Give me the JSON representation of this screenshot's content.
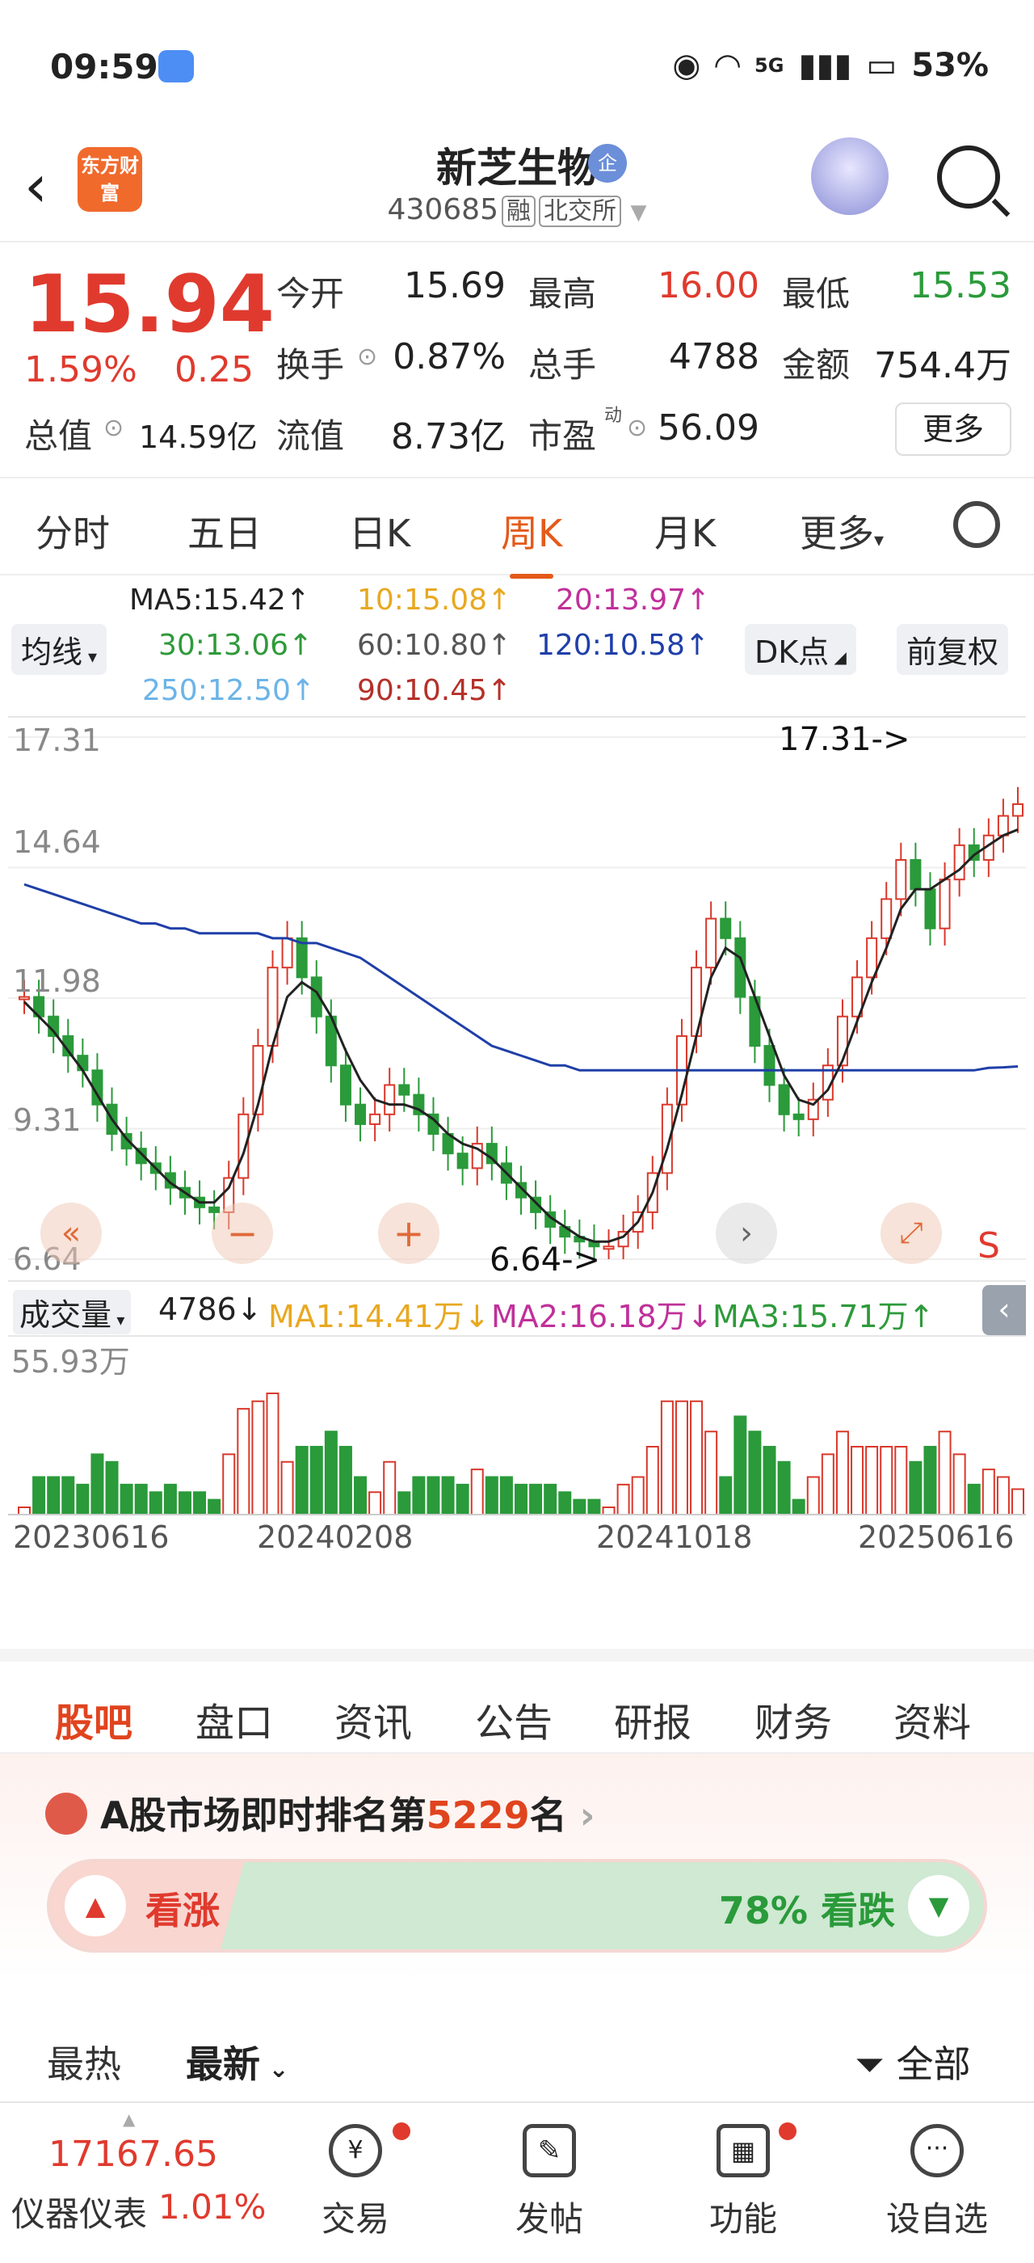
{
  "status": {
    "time": "09:59",
    "network": "5G",
    "battery": "53%"
  },
  "header": {
    "name": "新芝生物",
    "badge": "企",
    "code": "430685",
    "tags": [
      "融",
      "北交所"
    ],
    "logo_text": "东方财富"
  },
  "quote": {
    "price": "15.94",
    "change_pct": "1.59%",
    "change": "0.25",
    "open_label": "今开",
    "open": "15.69",
    "high_label": "最高",
    "high": "16.00",
    "low_label": "最低",
    "low": "15.53",
    "turnover_label": "换手",
    "turnover": "0.87%",
    "volume_label": "总手",
    "volume": "4788",
    "amount_label": "金额",
    "amount": "754.4万",
    "mktcap_label": "总值",
    "mktcap": "14.59亿",
    "float_label": "流值",
    "float": "8.73亿",
    "pe_label": "市盈",
    "pe_sup": "动",
    "pe": "56.09",
    "more": "更多"
  },
  "periods": [
    "分时",
    "五日",
    "日K",
    "周K",
    "月K",
    "更多"
  ],
  "active_period": "周K",
  "ma_legend": {
    "indicator": "均线",
    "dk": "DK点",
    "adjust": "前复权",
    "ma5": "MA5:15.42↑",
    "ma10": "10:15.08↑",
    "ma20": "20:13.97↑",
    "ma30": "30:13.06↑",
    "ma60": "60:10.80↑",
    "ma120": "120:10.58↑",
    "ma250": "250:12.50↑",
    "ma90": "90:10.45↑",
    "colors": {
      "ma5": "#222222",
      "ma10": "#f0b429",
      "ma20": "#c0309a",
      "ma30": "#2e9a3a",
      "ma60": "#555555",
      "ma120": "#1f3fa8",
      "ma250": "#6cb4e8",
      "ma90": "#b5302a"
    }
  },
  "chart_data": {
    "type": "candlestick",
    "y_ticks": [
      "17.31",
      "14.64",
      "11.98",
      "9.31",
      "6.64"
    ],
    "ylim": [
      6.64,
      17.31
    ],
    "max_label": "17.31->",
    "min_label": "6.64->",
    "x_ticks": [
      "20230616",
      "20240208",
      "20241018",
      "20250616"
    ],
    "close": [
      12.0,
      11.6,
      11.2,
      10.8,
      10.5,
      9.8,
      9.2,
      8.9,
      8.6,
      8.4,
      8.1,
      7.9,
      7.7,
      7.6,
      8.3,
      9.6,
      11.0,
      12.6,
      13.2,
      12.4,
      11.6,
      10.6,
      9.8,
      9.4,
      9.6,
      10.2,
      10.0,
      9.6,
      9.2,
      8.8,
      8.5,
      9.0,
      8.6,
      8.2,
      7.9,
      7.6,
      7.3,
      7.1,
      7.0,
      6.9,
      6.9,
      7.2,
      7.6,
      8.4,
      9.8,
      11.2,
      12.6,
      13.6,
      13.2,
      12.0,
      11.0,
      10.2,
      9.6,
      9.5,
      9.9,
      10.6,
      11.6,
      12.4,
      13.2,
      14.0,
      14.8,
      14.2,
      13.4,
      14.4,
      15.1,
      14.8,
      15.3,
      15.7,
      15.94
    ],
    "ma5": [
      11.9,
      11.6,
      11.3,
      10.9,
      10.5,
      10.0,
      9.5,
      9.1,
      8.8,
      8.5,
      8.2,
      8.0,
      7.8,
      7.8,
      8.1,
      8.8,
      9.8,
      11.0,
      12.0,
      12.3,
      12.1,
      11.6,
      10.9,
      10.3,
      9.9,
      9.8,
      9.8,
      9.7,
      9.5,
      9.2,
      9.0,
      8.9,
      8.7,
      8.4,
      8.1,
      7.8,
      7.5,
      7.3,
      7.1,
      7.0,
      7.0,
      7.1,
      7.4,
      8.0,
      8.9,
      10.0,
      11.2,
      12.4,
      13.0,
      12.8,
      12.0,
      11.2,
      10.4,
      9.9,
      9.8,
      10.1,
      10.7,
      11.5,
      12.3,
      13.0,
      13.8,
      14.2,
      14.2,
      14.4,
      14.6,
      14.9,
      15.1,
      15.3,
      15.42
    ],
    "ma120": [
      14.3,
      14.2,
      14.1,
      14.0,
      13.9,
      13.8,
      13.7,
      13.6,
      13.5,
      13.5,
      13.4,
      13.4,
      13.3,
      13.3,
      13.3,
      13.3,
      13.3,
      13.2,
      13.2,
      13.1,
      13.1,
      13.0,
      12.9,
      12.8,
      12.6,
      12.4,
      12.2,
      12.0,
      11.8,
      11.6,
      11.4,
      11.2,
      11.0,
      10.9,
      10.8,
      10.7,
      10.6,
      10.6,
      10.5,
      10.5,
      10.5,
      10.5,
      10.5,
      10.5,
      10.5,
      10.5,
      10.5,
      10.5,
      10.5,
      10.5,
      10.5,
      10.5,
      10.5,
      10.5,
      10.5,
      10.5,
      10.5,
      10.5,
      10.5,
      10.5,
      10.5,
      10.5,
      10.5,
      10.5,
      10.5,
      10.5,
      10.55,
      10.56,
      10.58
    ]
  },
  "vol_legend": {
    "label": "成交量",
    "vol": "4786↓",
    "ma1": "MA1:14.41万↓",
    "ma2": "MA2:16.18万↓",
    "ma3": "MA3:15.71万↑",
    "max": "55.93万"
  },
  "content_tabs": [
    "股吧",
    "盘口",
    "资讯",
    "公告",
    "研报",
    "财务",
    "资料"
  ],
  "rank": {
    "prefix": "A股市场即时排名第",
    "num": "5229",
    "suffix": "名"
  },
  "vote": {
    "up": "看涨",
    "down": "78% 看跌",
    "down_pct": 78
  },
  "sort": {
    "hot": "最热",
    "latest": "最新",
    "filter": "全部"
  },
  "bottom": {
    "index_value": "17167.65",
    "index_name": "仪器仪表",
    "index_change": "1.01%",
    "nav": [
      "交易",
      "发帖",
      "功能",
      "设自选"
    ]
  }
}
